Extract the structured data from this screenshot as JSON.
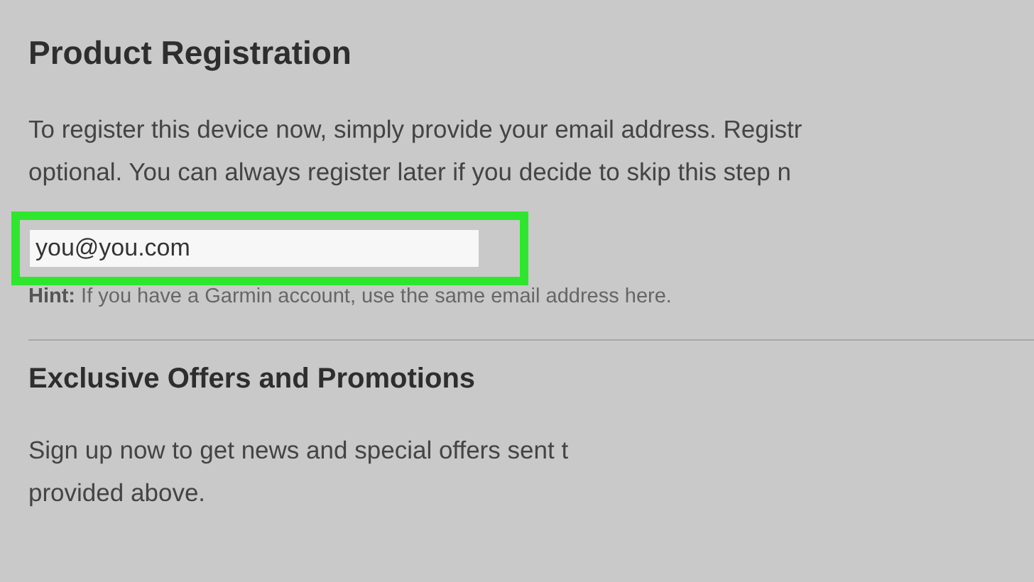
{
  "registration": {
    "title": "Product Registration",
    "description_lines": [
      "To register this device now, simply provide your email address. Registr",
      "optional. You can always register later if you decide to skip this step n"
    ],
    "email_field": {
      "value": "you@you.com",
      "highlighted": true
    },
    "hint": "**Hint:** If you have a Garmin account, use the same email address here."
  },
  "offers": {
    "title": "Exclusive Offers and Promotions",
    "description_lines": [
      "Sign up now to get news and special offers sent t",
      "provided above."
    ]
  }
}
